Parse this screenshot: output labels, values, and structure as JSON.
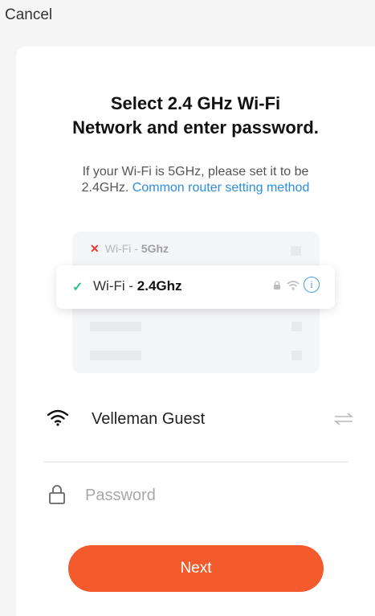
{
  "header": {
    "cancel_label": "Cancel"
  },
  "title": {
    "line1": "Select 2.4 GHz Wi-Fi",
    "line2": "Network and enter password."
  },
  "subtitle": {
    "line1": "If your Wi-Fi is 5GHz, please set it to be",
    "line2_prefix": "2.4GHz.",
    "link": "Common router setting method"
  },
  "illustration": {
    "bad": {
      "mark": "✕",
      "prefix": "Wi-Fi - ",
      "band": "5Ghz"
    },
    "good": {
      "mark": "✓",
      "prefix": "Wi-Fi - ",
      "band": "2.4Ghz"
    },
    "icons": [
      "lock-icon",
      "wifi-signal-icon",
      "info-icon"
    ]
  },
  "network": {
    "ssid": "Velleman Guest",
    "icon": "wifi-icon",
    "switch_icon": "swap-arrows-icon"
  },
  "password": {
    "placeholder": "Password",
    "value": "",
    "icon": "lock-icon"
  },
  "actions": {
    "next_label": "Next"
  },
  "colors": {
    "accent": "#f35b2c",
    "link": "#2b8de3",
    "success": "#2ec48a",
    "error": "#e53935"
  }
}
